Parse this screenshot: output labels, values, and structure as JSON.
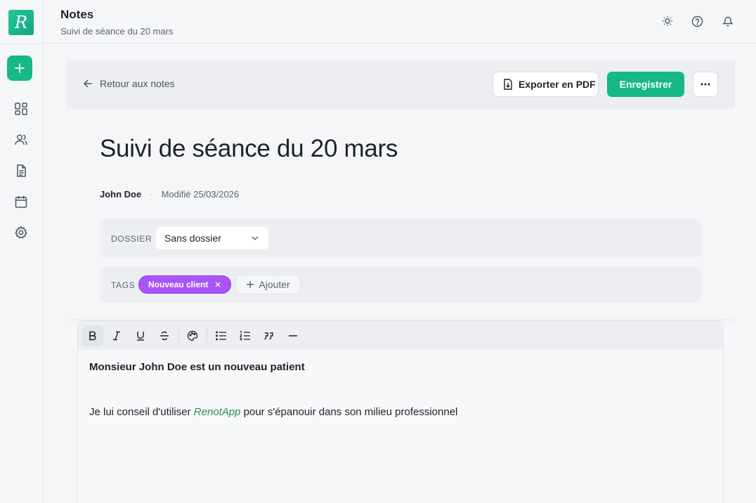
{
  "app": {
    "logo_letter": "R"
  },
  "header": {
    "title": "Notes",
    "subtitle": "Suivi de séance du 20 mars"
  },
  "sidebar": {
    "items": [
      {
        "name": "dashboard",
        "icon": "grid-icon"
      },
      {
        "name": "clients",
        "icon": "users-icon"
      },
      {
        "name": "notes",
        "icon": "file-text-icon"
      },
      {
        "name": "calendar",
        "icon": "calendar-icon"
      },
      {
        "name": "settings",
        "icon": "gear-icon"
      }
    ]
  },
  "toolbar": {
    "back_label": "Retour aux notes",
    "export_label": "Exporter en PDF",
    "save_label": "Enregistrer"
  },
  "note": {
    "title": "Suivi de séance du 20 mars",
    "author": "John Doe",
    "separator": "·",
    "modified": "Modifié 25/03/2026",
    "folder_label": "DOSSIER",
    "folder_value": "Sans dossier",
    "tags_label": "TAGS",
    "tags": [
      "Nouveau client"
    ],
    "add_tag_label": "Ajouter",
    "body_line1": "Monsieur John Doe est un nouveau patient",
    "body_line2_before": "Je lui conseil d'utiliser ",
    "body_line2_link": "RenotApp",
    "body_line2_after": " pour s'épanouir dans son milieu professionnel"
  },
  "colors": {
    "accent": "#15b886",
    "tag": "#a855f7",
    "link": "#2e8b57"
  }
}
